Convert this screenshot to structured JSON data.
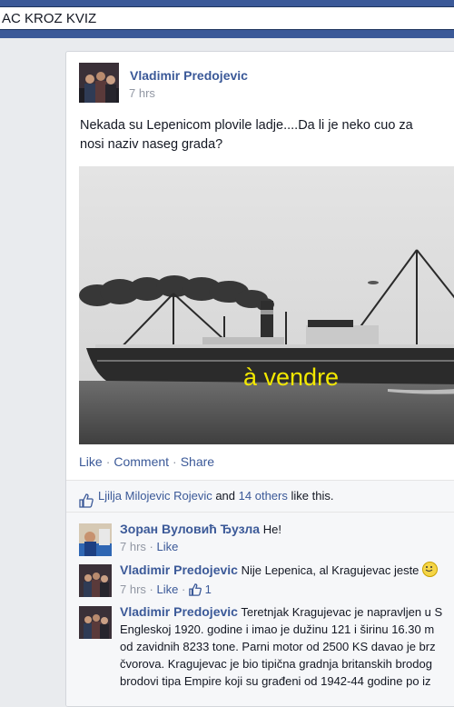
{
  "topbar": {
    "search_value": "AC KROZ KVIZ"
  },
  "post": {
    "author": "Vladimir Predojevic",
    "time": "7 hrs",
    "text_line1": "Nekada su Lepenicom plovile ladje....Da li je neko cuo za ",
    "text_line2": "nosi naziv naseg grada?",
    "photo_caption": "à vendre",
    "actions": {
      "like": "Like",
      "comment": "Comment",
      "share": "Share"
    },
    "likes": {
      "name": "Ljilja Milojevic Rojevic",
      "and": "and",
      "others": "14 others",
      "suffix": "like this."
    }
  },
  "comments": [
    {
      "author": "Зоран Вуловић Ђузла",
      "text": "Не!",
      "time": "7 hrs",
      "like": "Like"
    },
    {
      "author": "Vladimir Predojevic",
      "text": "Nije Lepenica, al Kragujevac jeste",
      "time": "7 hrs",
      "like": "Like",
      "like_count": "1"
    },
    {
      "author": "Vladimir Predojevic",
      "text_line1": "Teretnjak Kragujevac je napravljen u S",
      "text_line2": "Engleskoj 1920. godine i imao je dužinu 121 i širinu 16.30 m",
      "text_line3": "od zavidnih 8233 tone. Parni motor od 2500 KS davao je brz",
      "text_line4": "čvorova. Kragujevac je bio tipična gradnja britanskih brodog",
      "text_line5": "brodovi tipa Empire koji su građeni od 1942-44 godine po iz"
    }
  ],
  "colors": {
    "fb_blue": "#3b5998",
    "link": "#3b5998",
    "grey": "#9197a3"
  },
  "icons": {
    "thumb": "thumbs-up-icon",
    "smile": "smiley-emoji-icon"
  }
}
